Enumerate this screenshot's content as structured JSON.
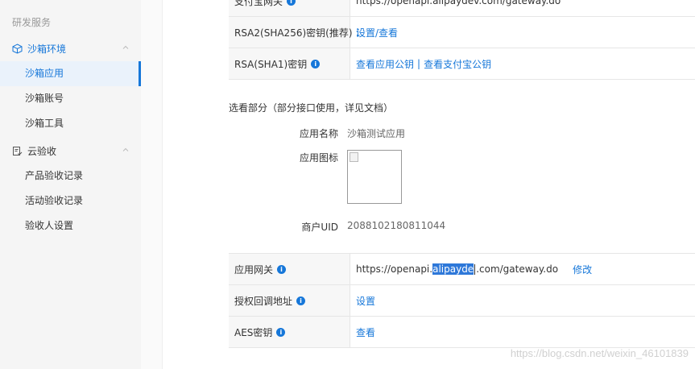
{
  "sidebar": {
    "section_label": "研发服务",
    "groups": [
      {
        "label": "沙箱环境",
        "items": [
          "沙箱应用",
          "沙箱账号",
          "沙箱工具"
        ]
      },
      {
        "label": "云验收",
        "items": [
          "产品验收记录",
          "活动验收记录",
          "验收人设置"
        ]
      }
    ],
    "active_item": "沙箱应用"
  },
  "top_table": {
    "rows": [
      {
        "label": "支付宝网关",
        "value": "https://openapi.alipaydev.com/gateway.do"
      },
      {
        "label": "RSA2(SHA256)密钥(推荐)",
        "value": "设置/查看"
      },
      {
        "label": "RSA(SHA1)密钥",
        "value_a": "查看应用公钥",
        "sep": "|",
        "value_b": "查看支付宝公钥"
      }
    ]
  },
  "optional": {
    "title": "选看部分（部分接口使用，详见文档）",
    "app_name_label": "应用名称",
    "app_name_value": "沙箱测试应用",
    "app_icon_label": "应用图标",
    "uid_label": "商户UID",
    "uid_value": "2088102180811044"
  },
  "bottom_table": {
    "gateway_label": "应用网关",
    "gateway_prefix": "https://openapi.",
    "gateway_selected": "alipayde",
    "gateway_suffix": ".com/gateway.do",
    "gateway_action": "修改",
    "callback_label": "授权回调地址",
    "callback_action": "设置",
    "aes_label": "AES密钥",
    "aes_action": "查看"
  },
  "watermark": "https://blog.csdn.net/weixin_46101839",
  "colors": {
    "accent": "#1677d9",
    "selection": "#2e78d9"
  }
}
